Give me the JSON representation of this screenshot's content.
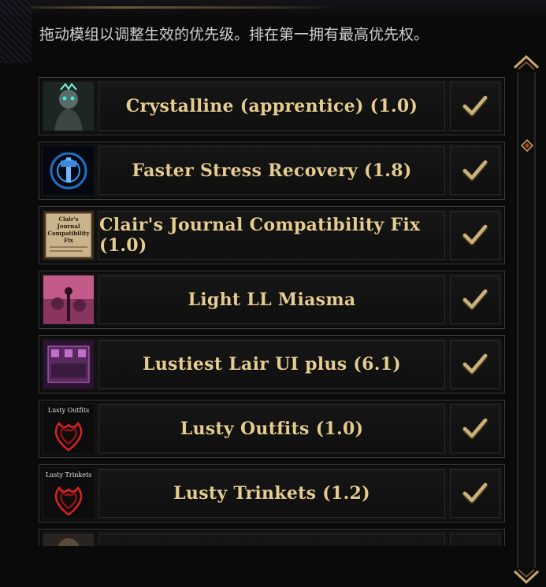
{
  "instructions": "拖动模组以调整生效的优先级。排在第一拥有最高优先权。",
  "mods": [
    {
      "name": "Crystalline (apprentice) (1.0)",
      "thumb": "crystalline",
      "checked": true
    },
    {
      "name": "Faster Stress Recovery (1.8)",
      "thumb": "stress",
      "checked": true
    },
    {
      "name": "Clair's Journal Compatibility Fix (1.0)",
      "thumb": "journal",
      "thumb_text": "Clair's Journal Compatibility Fix",
      "checked": true
    },
    {
      "name": "Light LL Miasma",
      "thumb": "miasma",
      "checked": true
    },
    {
      "name": "Lustiest Lair UI plus (6.1)",
      "thumb": "lair",
      "checked": true
    },
    {
      "name": "Lusty Outfits (1.0)",
      "thumb": "outfits",
      "thumb_text": "Lusty Outfits",
      "checked": true
    },
    {
      "name": "Lusty Trinkets (1.2)",
      "thumb": "trinkets",
      "thumb_text": "Lusty Trinkets",
      "checked": true
    },
    {
      "name": "",
      "thumb": "partial",
      "checked": true
    }
  ],
  "colors": {
    "title": "#e5cc8f",
    "check": "#c9b27a",
    "text": "#cfcfcf"
  }
}
